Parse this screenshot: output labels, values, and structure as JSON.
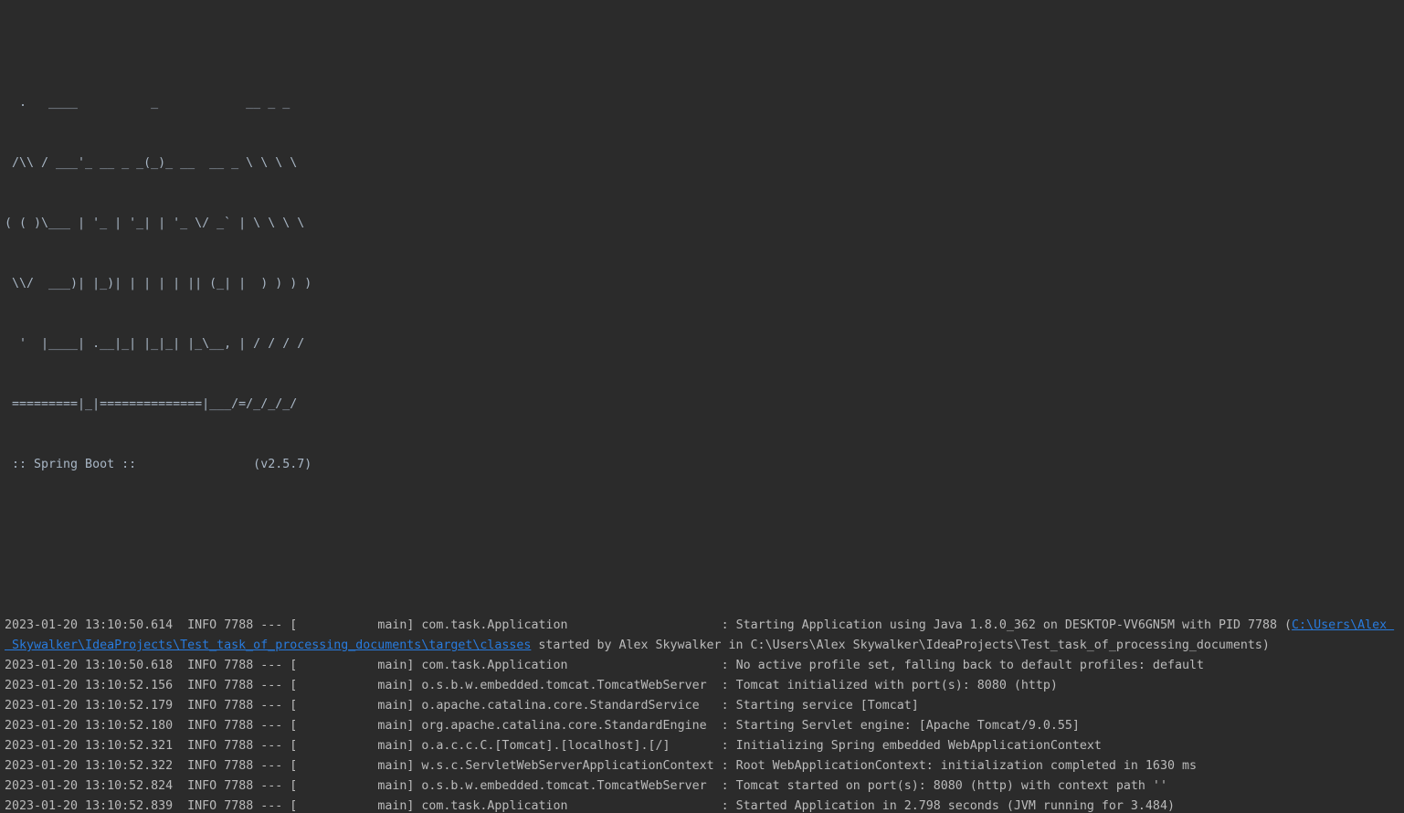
{
  "colors": {
    "background": "#2b2b2b",
    "text": "#bbbbbb",
    "link": "#287bde"
  },
  "banner": [
    "  .   ____          _            __ _ _",
    " /\\\\ / ___'_ __ _ _(_)_ __  __ _ \\ \\ \\ \\",
    "( ( )\\___ | '_ | '_| | '_ \\/ _` | \\ \\ \\ \\",
    " \\\\/  ___)| |_)| | | | | || (_| |  ) ) ) )",
    "  '  |____| .__|_| |_|_| |_\\__, | / / / /",
    " =========|_|==============|___/=/_/_/_/",
    " :: Spring Boot ::                (v2.5.7)"
  ],
  "logs": [
    {
      "ts": "2023-01-20 13:10:50.614",
      "level": "INFO",
      "pid": "7788",
      "thread": "main",
      "logger": "com.task.Application",
      "message": "Starting Application using Java 1.8.0_362 on DESKTOP-VV6GN5M with PID 7788 (",
      "link_part1": "C:\\Users\\Alex ",
      "link_part2": " Skywalker\\IdeaProjects\\Test_task_of_processing_documents\\target\\classes",
      "message_tail": " started by Alex Skywalker in C:\\Users\\Alex Skywalker\\IdeaProjects\\Test_task_of_processing_documents)"
    },
    {
      "ts": "2023-01-20 13:10:50.618",
      "level": "INFO",
      "pid": "7788",
      "thread": "main",
      "logger": "com.task.Application",
      "message": "No active profile set, falling back to default profiles: default"
    },
    {
      "ts": "2023-01-20 13:10:52.156",
      "level": "INFO",
      "pid": "7788",
      "thread": "main",
      "logger": "o.s.b.w.embedded.tomcat.TomcatWebServer",
      "message": "Tomcat initialized with port(s): 8080 (http)"
    },
    {
      "ts": "2023-01-20 13:10:52.179",
      "level": "INFO",
      "pid": "7788",
      "thread": "main",
      "logger": "o.apache.catalina.core.StandardService",
      "message": "Starting service [Tomcat]"
    },
    {
      "ts": "2023-01-20 13:10:52.180",
      "level": "INFO",
      "pid": "7788",
      "thread": "main",
      "logger": "org.apache.catalina.core.StandardEngine",
      "message": "Starting Servlet engine: [Apache Tomcat/9.0.55]"
    },
    {
      "ts": "2023-01-20 13:10:52.321",
      "level": "INFO",
      "pid": "7788",
      "thread": "main",
      "logger": "o.a.c.c.C.[Tomcat].[localhost].[/]",
      "message": "Initializing Spring embedded WebApplicationContext"
    },
    {
      "ts": "2023-01-20 13:10:52.322",
      "level": "INFO",
      "pid": "7788",
      "thread": "main",
      "logger": "w.s.c.ServletWebServerApplicationContext",
      "message": "Root WebApplicationContext: initialization completed in 1630 ms"
    },
    {
      "ts": "2023-01-20 13:10:52.824",
      "level": "INFO",
      "pid": "7788",
      "thread": "main",
      "logger": "o.s.b.w.embedded.tomcat.TomcatWebServer",
      "message": "Tomcat started on port(s): 8080 (http) with context path ''"
    },
    {
      "ts": "2023-01-20 13:10:52.839",
      "level": "INFO",
      "pid": "7788",
      "thread": "main",
      "logger": "com.task.Application",
      "message": "Started Application in 2.798 seconds (JVM running for 3.484)"
    }
  ]
}
